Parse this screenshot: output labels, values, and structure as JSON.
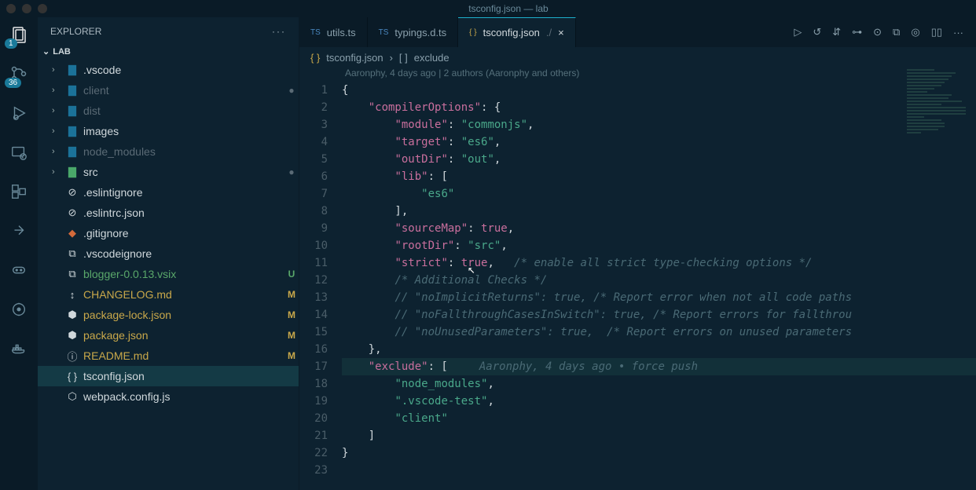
{
  "window": {
    "title": "tsconfig.json — lab"
  },
  "sidebar": {
    "title": "EXPLORER",
    "section": "LAB",
    "tree": [
      {
        "type": "folder",
        "name": ".vscode",
        "expanded": false
      },
      {
        "type": "folder",
        "name": "client",
        "expanded": false,
        "ignored": true,
        "dot": true
      },
      {
        "type": "folder",
        "name": "dist",
        "expanded": false,
        "ignored": true
      },
      {
        "type": "folder",
        "name": "images",
        "expanded": false
      },
      {
        "type": "folder",
        "name": "node_modules",
        "expanded": false,
        "ignored": true
      },
      {
        "type": "folder",
        "name": "src",
        "expanded": false,
        "srcColor": true,
        "dot": true
      },
      {
        "type": "file",
        "name": ".eslintignore",
        "icon": "⊘"
      },
      {
        "type": "file",
        "name": ".eslintrc.json",
        "icon": "⊘"
      },
      {
        "type": "file",
        "name": ".gitignore",
        "icon": "◆",
        "giColor": true
      },
      {
        "type": "file",
        "name": ".vscodeignore",
        "icon": "⧉"
      },
      {
        "type": "file",
        "name": "blogger-0.0.13.vsix",
        "icon": "⧉",
        "status": "U",
        "statusClass": "unt"
      },
      {
        "type": "file",
        "name": "CHANGELOG.md",
        "icon": "↕",
        "status": "M",
        "statusClass": "mod"
      },
      {
        "type": "file",
        "name": "package-lock.json",
        "icon": "⬢",
        "status": "M",
        "statusClass": "mod"
      },
      {
        "type": "file",
        "name": "package.json",
        "icon": "⬢",
        "status": "M",
        "statusClass": "mod"
      },
      {
        "type": "file",
        "name": "README.md",
        "icon": "ⓘ",
        "status": "M",
        "statusClass": "mod"
      },
      {
        "type": "file",
        "name": "tsconfig.json",
        "icon": "{ }",
        "selected": true
      },
      {
        "type": "file",
        "name": "webpack.config.js",
        "icon": "⬡"
      }
    ]
  },
  "activitybar": {
    "explorer_badge": "1",
    "git_badge": "36"
  },
  "tabs": [
    {
      "label": "utils.ts",
      "icon": "TS",
      "active": false
    },
    {
      "label": "typings.d.ts",
      "icon": "TS",
      "active": false
    },
    {
      "label": "tsconfig.json",
      "icon": "{ }",
      "active": true,
      "path": "./",
      "closeable": true
    }
  ],
  "breadcrumb": {
    "file": "tsconfig.json",
    "symbol": "exclude"
  },
  "blame_header": "Aaronphy, 4 days ago | 2 authors (Aaronphy and others)",
  "inline_blame": "Aaronphy, 4 days ago • force push",
  "code": {
    "lines": [
      [
        {
          "c": "tok-p",
          "t": "{"
        }
      ],
      [
        {
          "c": "tok-p",
          "t": "    "
        },
        {
          "c": "tok-k",
          "t": "\"compilerOptions\""
        },
        {
          "c": "tok-p",
          "t": ": {"
        }
      ],
      [
        {
          "c": "tok-p",
          "t": "        "
        },
        {
          "c": "tok-k",
          "t": "\"module\""
        },
        {
          "c": "tok-p",
          "t": ": "
        },
        {
          "c": "tok-s",
          "t": "\"commonjs\""
        },
        {
          "c": "tok-p",
          "t": ","
        }
      ],
      [
        {
          "c": "tok-p",
          "t": "        "
        },
        {
          "c": "tok-k",
          "t": "\"target\""
        },
        {
          "c": "tok-p",
          "t": ": "
        },
        {
          "c": "tok-s",
          "t": "\"es6\""
        },
        {
          "c": "tok-p",
          "t": ","
        }
      ],
      [
        {
          "c": "tok-p",
          "t": "        "
        },
        {
          "c": "tok-k",
          "t": "\"outDir\""
        },
        {
          "c": "tok-p",
          "t": ": "
        },
        {
          "c": "tok-s",
          "t": "\"out\""
        },
        {
          "c": "tok-p",
          "t": ","
        }
      ],
      [
        {
          "c": "tok-p",
          "t": "        "
        },
        {
          "c": "tok-k",
          "t": "\"lib\""
        },
        {
          "c": "tok-p",
          "t": ": ["
        }
      ],
      [
        {
          "c": "tok-p",
          "t": "            "
        },
        {
          "c": "tok-s",
          "t": "\"es6\""
        }
      ],
      [
        {
          "c": "tok-p",
          "t": "        ],"
        }
      ],
      [
        {
          "c": "tok-p",
          "t": "        "
        },
        {
          "c": "tok-k",
          "t": "\"sourceMap\""
        },
        {
          "c": "tok-p",
          "t": ": "
        },
        {
          "c": "tok-b",
          "t": "true"
        },
        {
          "c": "tok-p",
          "t": ","
        }
      ],
      [
        {
          "c": "tok-p",
          "t": "        "
        },
        {
          "c": "tok-k",
          "t": "\"rootDir\""
        },
        {
          "c": "tok-p",
          "t": ": "
        },
        {
          "c": "tok-s",
          "t": "\"src\""
        },
        {
          "c": "tok-p",
          "t": ","
        }
      ],
      [
        {
          "c": "tok-p",
          "t": "        "
        },
        {
          "c": "tok-k",
          "t": "\"strict\""
        },
        {
          "c": "tok-p",
          "t": ": "
        },
        {
          "c": "tok-b",
          "t": "true"
        },
        {
          "c": "tok-p",
          "t": ",   "
        },
        {
          "c": "tok-c",
          "t": "/* enable all strict type-checking options */"
        }
      ],
      [
        {
          "c": "tok-p",
          "t": "        "
        },
        {
          "c": "tok-c",
          "t": "/* Additional Checks */"
        }
      ],
      [
        {
          "c": "tok-p",
          "t": "        "
        },
        {
          "c": "tok-c",
          "t": "// \"noImplicitReturns\": true, /* Report error when not all code paths"
        }
      ],
      [
        {
          "c": "tok-p",
          "t": "        "
        },
        {
          "c": "tok-c",
          "t": "// \"noFallthroughCasesInSwitch\": true, /* Report errors for fallthrou"
        }
      ],
      [
        {
          "c": "tok-p",
          "t": "        "
        },
        {
          "c": "tok-c",
          "t": "// \"noUnusedParameters\": true,  /* Report errors on unused parameters"
        }
      ],
      [
        {
          "c": "tok-p",
          "t": "    },"
        }
      ],
      [
        {
          "c": "tok-p",
          "t": "    "
        },
        {
          "c": "tok-k",
          "t": "\"exclude\""
        },
        {
          "c": "tok-p",
          "t": ": ["
        },
        {
          "c": "inline-blame",
          "t": "",
          "blame": true
        }
      ],
      [
        {
          "c": "tok-p",
          "t": "        "
        },
        {
          "c": "tok-s",
          "t": "\"node_modules\""
        },
        {
          "c": "tok-p",
          "t": ","
        }
      ],
      [
        {
          "c": "tok-p",
          "t": "        "
        },
        {
          "c": "tok-s",
          "t": "\".vscode-test\""
        },
        {
          "c": "tok-p",
          "t": ","
        }
      ],
      [
        {
          "c": "tok-p",
          "t": "        "
        },
        {
          "c": "tok-s",
          "t": "\"client\""
        }
      ],
      [
        {
          "c": "tok-p",
          "t": "    ]"
        }
      ],
      [
        {
          "c": "tok-p",
          "t": "}"
        }
      ],
      [
        {
          "c": "tok-p",
          "t": ""
        }
      ]
    ],
    "highlight_line": 17
  }
}
